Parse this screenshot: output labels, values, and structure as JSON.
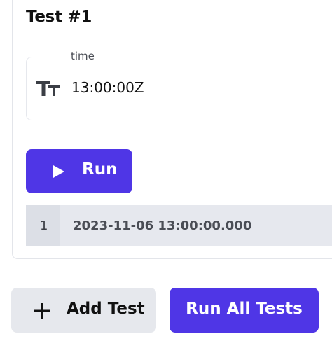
{
  "test": {
    "title": "Test #1",
    "field": {
      "label": "time",
      "type_icon": "text-type-icon",
      "value": "13:00:00Z"
    },
    "run_label": "Run",
    "result": {
      "index": "1",
      "value": "2023-11-06 13:00:00.000"
    }
  },
  "actions": {
    "add_test_label": "Add Test",
    "run_all_label": "Run All Tests"
  },
  "colors": {
    "primary": "#4f36e6",
    "secondary_bg": "#e6e8ed"
  }
}
